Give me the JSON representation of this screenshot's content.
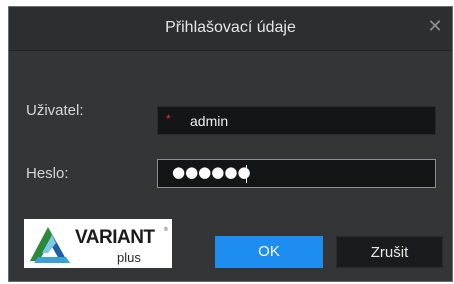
{
  "window": {
    "title": "Přihlašovací údaje",
    "close_icon": "close-icon"
  },
  "form": {
    "username_label": "Uživatel:",
    "username_value": "admin",
    "username_required_mark": "*",
    "password_label": "Heslo:",
    "password_masked": "●●●●●●"
  },
  "logo": {
    "brand": "VARIANT",
    "sub": "plus",
    "reg_mark": "®"
  },
  "buttons": {
    "ok_label": "OK",
    "cancel_label": "Zrušit"
  },
  "colors": {
    "dialog_bg": "#333537",
    "accent": "#1e8df2",
    "required": "#e03030"
  }
}
